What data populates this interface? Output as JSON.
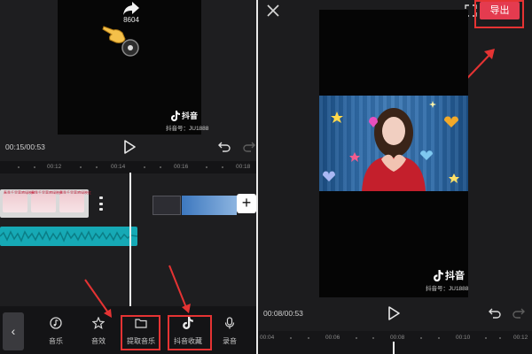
{
  "left": {
    "preview": {
      "share_count": "8604",
      "watermark": "抖音",
      "account_id": "抖音号：JU1888"
    },
    "current_time": "00:15/00:53",
    "ruler_ticks": [
      "00:12",
      "00:14",
      "00:16",
      "00:18"
    ],
    "clip_caption": "春季千里莺啼绿映红",
    "toolbar": {
      "back_glyph": "‹",
      "add_glyph": "+",
      "items": [
        {
          "label": "音乐",
          "icon": "music-note-icon"
        },
        {
          "label": "音效",
          "icon": "sound-effect-icon"
        },
        {
          "label": "提取音乐",
          "icon": "folder-icon"
        },
        {
          "label": "抖音收藏",
          "icon": "douyin-icon"
        },
        {
          "label": "录音",
          "icon": "microphone-icon"
        }
      ]
    }
  },
  "right": {
    "export_label": "导出",
    "preview": {
      "watermark": "抖音",
      "account_id": "抖音号：JU1888"
    },
    "current_time": "00:08/00:53",
    "ruler_ticks": [
      "00:04",
      "00:06",
      "00:08",
      "00:10",
      "00:12"
    ]
  },
  "colors": {
    "highlight": "#e53333",
    "export": "#e43b4f",
    "audio_track": "#16a9b5"
  }
}
